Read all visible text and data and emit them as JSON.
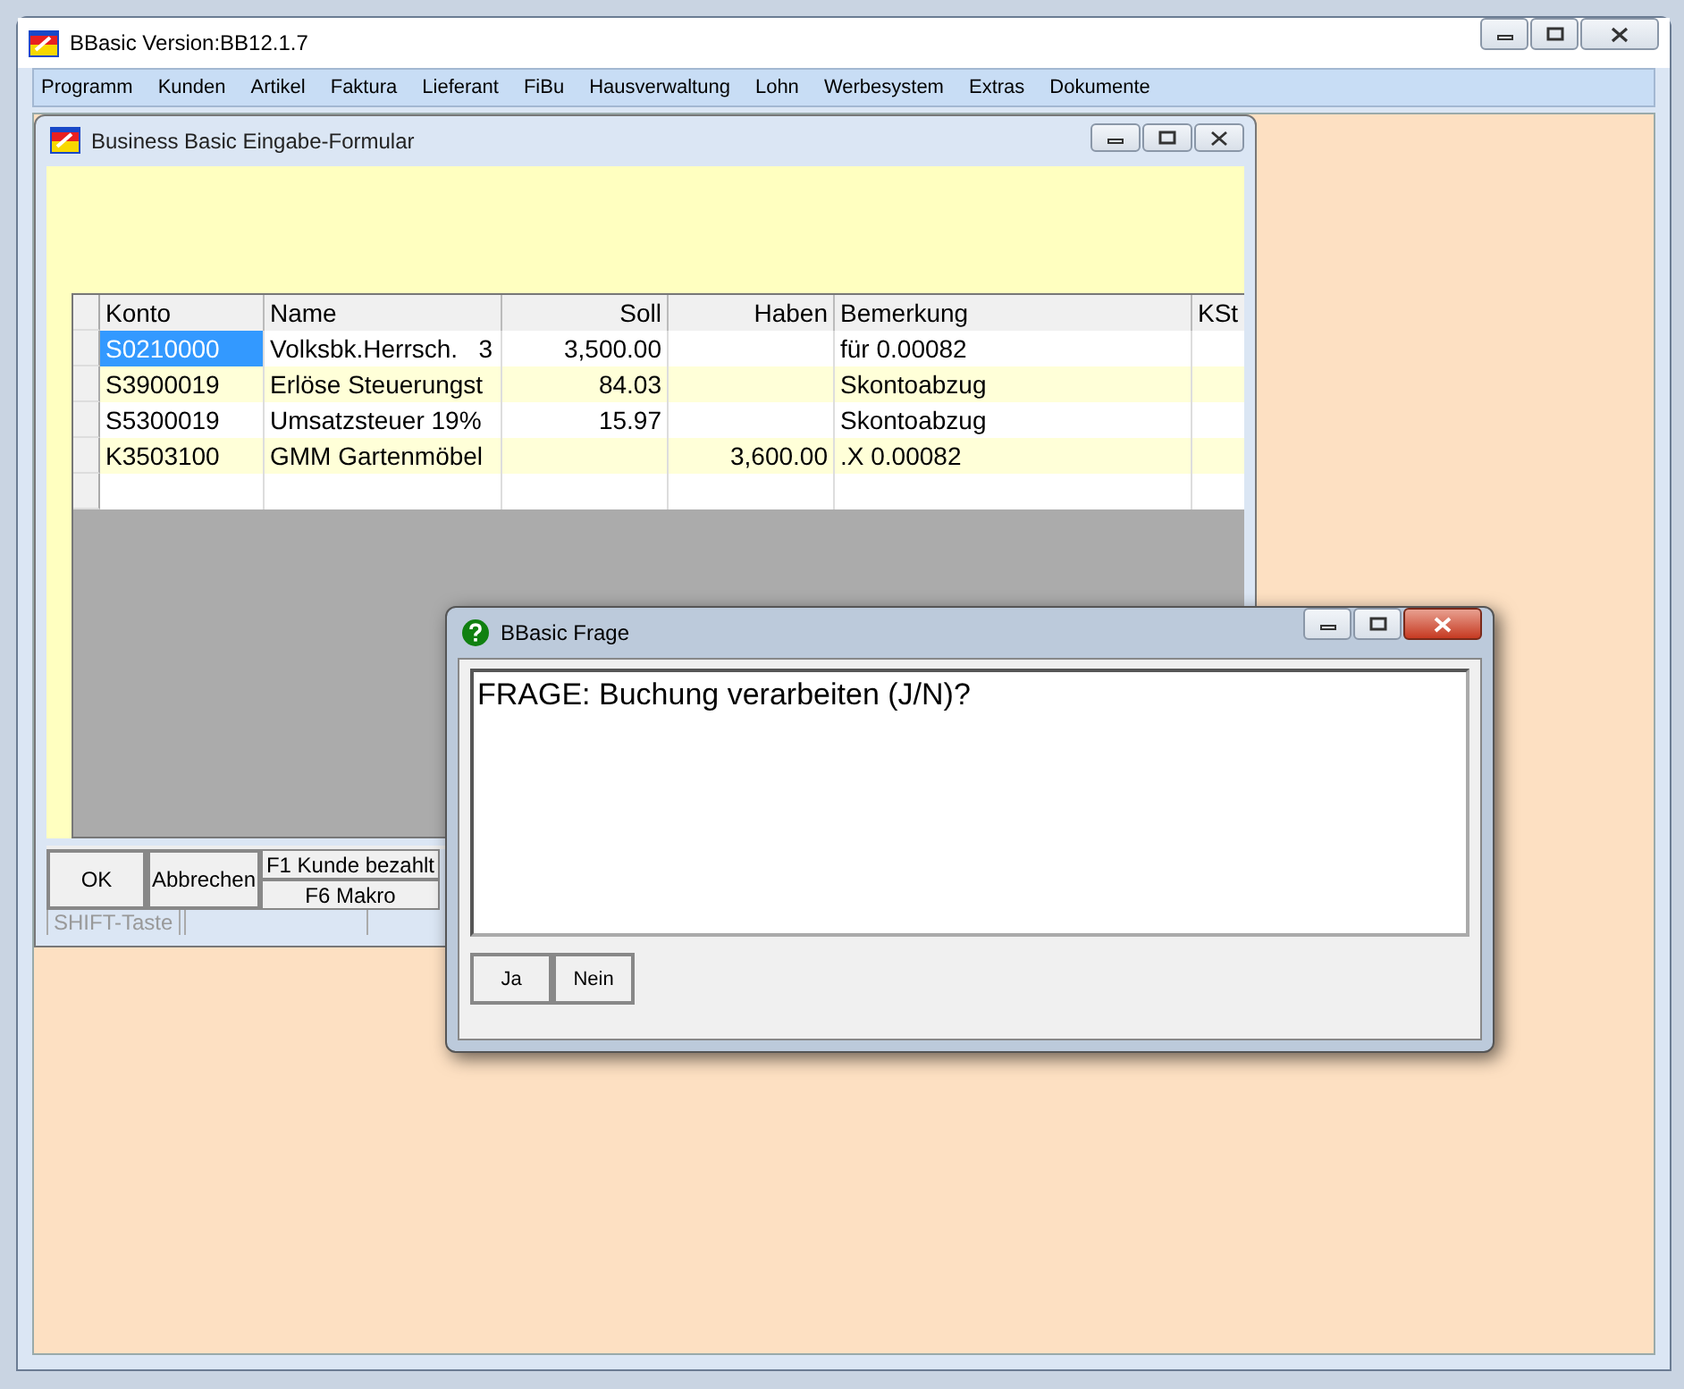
{
  "window": {
    "title": "BBasic Version:BB12.1.7"
  },
  "menu": [
    {
      "label": "Programm"
    },
    {
      "label": "Kunden"
    },
    {
      "label": "Artikel"
    },
    {
      "label": "Faktura"
    },
    {
      "label": "Lieferant"
    },
    {
      "label": "FiBu"
    },
    {
      "label": "Hausverwaltung"
    },
    {
      "label": "Lohn"
    },
    {
      "label": "Werbesystem"
    },
    {
      "label": "Extras"
    },
    {
      "label": "Dokumente"
    }
  ],
  "form": {
    "title": "Business Basic Eingabe-Formular",
    "table": {
      "columns": [
        "Konto",
        "Name",
        "Soll",
        "Haben",
        "Bemerkung",
        "KSt"
      ],
      "rows": [
        {
          "selected": true,
          "cells": [
            "S0210000",
            "Volksbk.Herrsch.   3",
            "3,500.00",
            "",
            "für 0.00082",
            ""
          ]
        },
        {
          "selected": false,
          "cells": [
            "S3900019",
            "Erlöse Steuerungst",
            "84.03",
            "",
            "Skontoabzug",
            ""
          ]
        },
        {
          "selected": false,
          "cells": [
            "S5300019",
            "Umsatzsteuer 19%",
            "15.97",
            "",
            "Skontoabzug",
            ""
          ]
        },
        {
          "selected": false,
          "cells": [
            "K3503100",
            "GMM Gartenmöbel",
            "",
            "3,600.00",
            ".X 0.00082",
            ""
          ]
        }
      ]
    },
    "buttons": {
      "ok": "OK",
      "cancel": "Abbrechen",
      "f1": "F1 Kunde bezahlt",
      "f6": "F6 Makro"
    },
    "status_bar": [
      "SHIFT-Taste"
    ]
  },
  "dialog": {
    "title": "BBasic Frage",
    "message": "FRAGE: Buchung verarbeiten (J/N)?",
    "buttons": [
      "Ja",
      "Nein"
    ]
  }
}
